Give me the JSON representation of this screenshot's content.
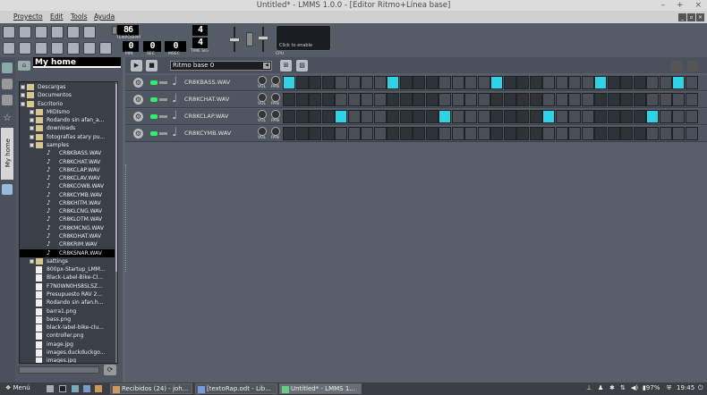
{
  "window": {
    "title": "Untitled* - LMMS 1.0.0 - [Editor Ritmo+Línea base]",
    "controls": [
      "–",
      "+",
      "×"
    ]
  },
  "menu": {
    "items": [
      "Proyecto",
      "Edit",
      "Tools",
      "Ayuda"
    ],
    "mdi_controls": [
      "_",
      "▫",
      "×"
    ]
  },
  "toolbar": {
    "tempo": {
      "value": "86",
      "label": "TEMPO/BPM"
    },
    "time_min": {
      "value": "0",
      "label": "MIN"
    },
    "time_sec": {
      "value": "0",
      "label": "SEC"
    },
    "time_msec": {
      "value": "0",
      "label": "MSEC"
    },
    "timesig_num": "4",
    "timesig_den": "4",
    "timesig_label": "TIME SIG",
    "cpu_text": "Click to enable",
    "cpu_label": "CPU"
  },
  "sidebar": {
    "tab_label": "My home"
  },
  "browser": {
    "title": "My home",
    "items": [
      {
        "label": "Descargas",
        "type": "folder",
        "level": 0
      },
      {
        "label": "Documentos",
        "type": "folder",
        "level": 0
      },
      {
        "label": "Escritorio",
        "type": "folder",
        "level": 0
      },
      {
        "label": "MIDIsmo",
        "type": "folder",
        "level": 1
      },
      {
        "label": "Rodando sin afan_a...",
        "type": "folder",
        "level": 1
      },
      {
        "label": "downloads",
        "type": "folder",
        "level": 1
      },
      {
        "label": "fotografías atary pu...",
        "type": "folder",
        "level": 1
      },
      {
        "label": "samples",
        "type": "folder",
        "level": 1
      },
      {
        "label": "CR8KBASS.WAV",
        "type": "sample",
        "level": 2
      },
      {
        "label": "CR8KCHAT.WAV",
        "type": "sample",
        "level": 2
      },
      {
        "label": "CR8KCLAP.WAV",
        "type": "sample",
        "level": 2
      },
      {
        "label": "CR8KCLAV.WAV",
        "type": "sample",
        "level": 2
      },
      {
        "label": "CR8KCOWB.WAV",
        "type": "sample",
        "level": 2
      },
      {
        "label": "CR8KCYMB.WAV",
        "type": "sample",
        "level": 2
      },
      {
        "label": "CR8KHITM.WAV",
        "type": "sample",
        "level": 2
      },
      {
        "label": "CR8KLCNG.WAV",
        "type": "sample",
        "level": 2
      },
      {
        "label": "CR8KLOTM.WAV",
        "type": "sample",
        "level": 2
      },
      {
        "label": "CR8KMCNG.WAV",
        "type": "sample",
        "level": 2
      },
      {
        "label": "CR8KOHAT.WAV",
        "type": "sample",
        "level": 2
      },
      {
        "label": "CR8KRIM.WAV",
        "type": "sample",
        "level": 2
      },
      {
        "label": "CR8KSNAR.WAV",
        "type": "sample",
        "level": 2,
        "selected": true
      },
      {
        "label": "sattings",
        "type": "folder",
        "level": 1
      },
      {
        "label": "800px-Startup_LMM...",
        "type": "file",
        "level": 1
      },
      {
        "label": "Black-Label-Bike-Cl...",
        "type": "file",
        "level": 1
      },
      {
        "label": "F7N0WN0HS8SLSZ...",
        "type": "file",
        "level": 1
      },
      {
        "label": "Presupuesto RAV 2...",
        "type": "file",
        "level": 1
      },
      {
        "label": "Rodando sin afan.h...",
        "type": "file",
        "level": 1
      },
      {
        "label": "barra1.png",
        "type": "file",
        "level": 1
      },
      {
        "label": "bass.png",
        "type": "file",
        "level": 1
      },
      {
        "label": "black-label-bike-clu...",
        "type": "file",
        "level": 1
      },
      {
        "label": "controller.png",
        "type": "file",
        "level": 1
      },
      {
        "label": "image.jpg",
        "type": "file",
        "level": 1
      },
      {
        "label": "images.duckduckgo...",
        "type": "file",
        "level": 1
      },
      {
        "label": "images.jpg",
        "type": "file",
        "level": 1
      }
    ]
  },
  "editor": {
    "pattern_name": "Ritmo base 0",
    "vol_label": "VOL",
    "pan_label": "PAN",
    "tracks": [
      {
        "name": "CR8KBASS.WAV",
        "steps": [
          1,
          0,
          0,
          0,
          0,
          0,
          0,
          0,
          1,
          0,
          0,
          0,
          0,
          0,
          0,
          0,
          1,
          0,
          0,
          0,
          0,
          0,
          0,
          0,
          1,
          0,
          0,
          0,
          0,
          0,
          1,
          0
        ]
      },
      {
        "name": "CR8KCHAT.WAV",
        "steps": [
          0,
          0,
          0,
          0,
          0,
          0,
          0,
          0,
          0,
          0,
          0,
          0,
          0,
          0,
          0,
          0,
          0,
          0,
          0,
          0,
          0,
          0,
          0,
          0,
          0,
          0,
          0,
          0,
          0,
          0,
          0,
          0
        ]
      },
      {
        "name": "CR8KCLAP.WAV",
        "steps": [
          0,
          0,
          0,
          0,
          1,
          0,
          0,
          0,
          0,
          0,
          0,
          0,
          1,
          0,
          0,
          0,
          0,
          0,
          0,
          0,
          1,
          0,
          0,
          0,
          0,
          0,
          0,
          0,
          1,
          0,
          0,
          0
        ]
      },
      {
        "name": "CR8KCYMB.WAV",
        "steps": [
          0,
          0,
          0,
          0,
          0,
          0,
          0,
          0,
          0,
          0,
          0,
          0,
          0,
          0,
          0,
          0,
          0,
          0,
          0,
          0,
          0,
          0,
          0,
          0,
          0,
          0,
          0,
          0,
          0,
          0,
          0,
          0
        ]
      }
    ]
  },
  "taskbar": {
    "menu_label": "Menú",
    "items": [
      {
        "label": "Recibidos (24) - joh...",
        "active": false
      },
      {
        "label": "[textoRap.odt - Lib...",
        "active": false
      },
      {
        "label": "Untitled* - LMMS 1...",
        "active": true
      }
    ],
    "battery": "97%",
    "clock": "19:45"
  },
  "colors": {
    "step_on": "#2ed3e6",
    "led": "#2ef070",
    "background": "#5b6270"
  }
}
